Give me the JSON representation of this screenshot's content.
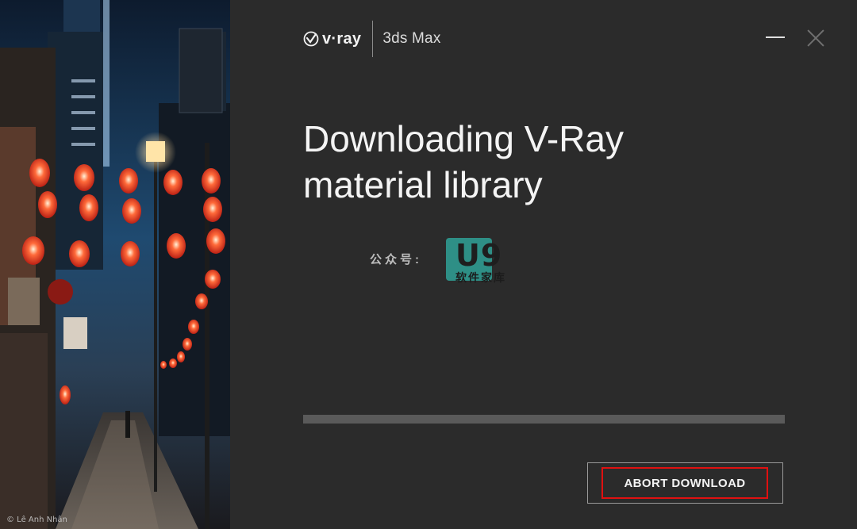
{
  "photo": {
    "credit": "© Lê Anh Nhân"
  },
  "header": {
    "logo_text": "v·ray",
    "product": "3ds Max",
    "minimize_icon": "minimize-icon",
    "close_icon": "close-icon"
  },
  "main": {
    "title": "Downloading V-Ray material library",
    "progress_percent": 0
  },
  "watermark": {
    "prefix": "公众号:",
    "mark": "U9",
    "sub": "软件家库"
  },
  "footer": {
    "abort_label": "ABORT DOWNLOAD"
  },
  "colors": {
    "background": "#2b2b2b",
    "accent_outline": "#e01010",
    "progress_track": "#5a5a5a"
  }
}
